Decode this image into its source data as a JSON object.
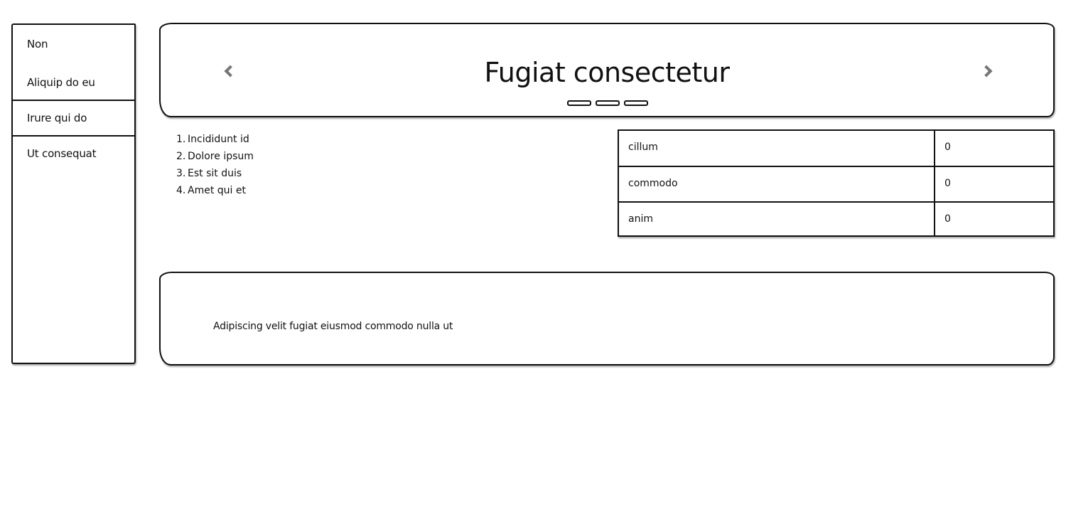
{
  "sidebar": {
    "items": [
      {
        "label": "Non"
      },
      {
        "label": "Aliquip do eu"
      },
      {
        "label": "Irure qui do"
      },
      {
        "label": "Ut consequat"
      }
    ]
  },
  "carousel": {
    "title": "Fugiat consectetur",
    "prev_icon": "chevron-left-icon",
    "next_icon": "chevron-right-icon",
    "indicator_count": 3
  },
  "ordered_list": {
    "items": [
      {
        "num": "1.",
        "text": "Incididunt id"
      },
      {
        "num": "2.",
        "text": "Dolore ipsum"
      },
      {
        "num": "3.",
        "text": "Est sit duis"
      },
      {
        "num": "4.",
        "text": "Amet qui et"
      }
    ]
  },
  "table": {
    "rows": [
      {
        "name": "cillum",
        "value": "0"
      },
      {
        "name": "commodo",
        "value": "0"
      },
      {
        "name": "anim",
        "value": "0"
      }
    ]
  },
  "text_panel": {
    "text": "Adipiscing velit fugiat eiusmod commodo nulla ut"
  }
}
